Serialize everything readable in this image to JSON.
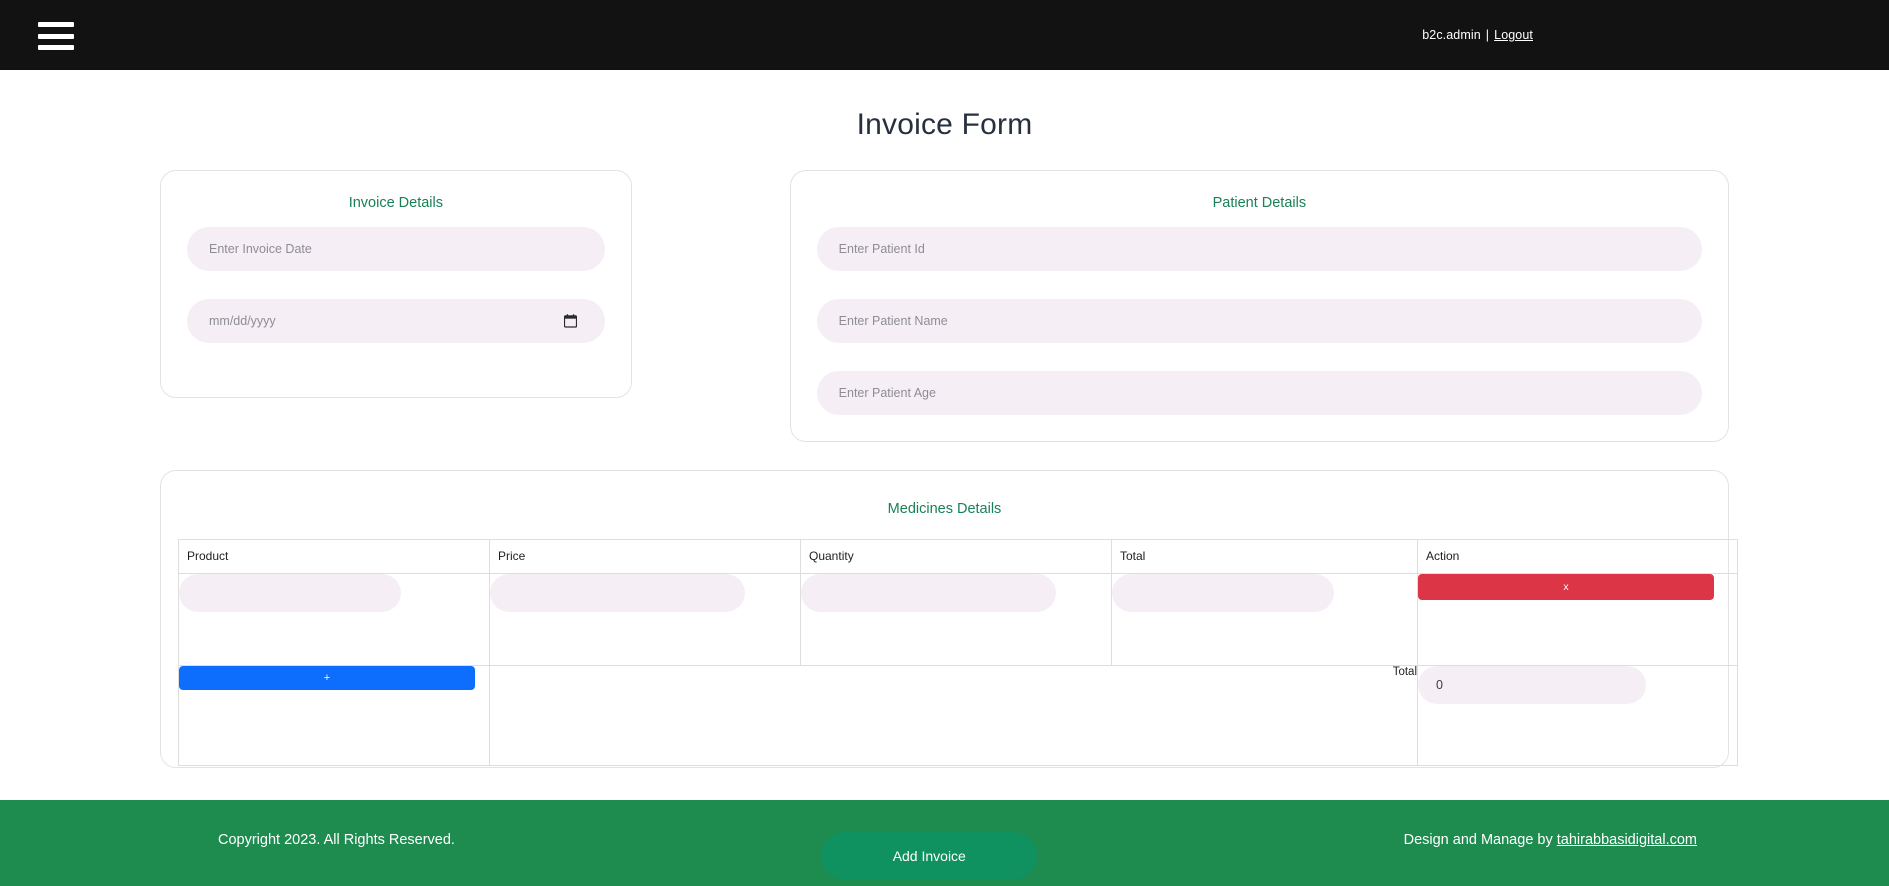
{
  "navbar": {
    "menu_icon": "hamburger-menu-icon",
    "user": "b2c.admin",
    "separator": "|",
    "logout": "Logout"
  },
  "page": {
    "title": "Invoice Form"
  },
  "invoice_details": {
    "title": "Invoice Details",
    "fields": [
      {
        "name": "invoice-date-text",
        "placeholder": "Enter Invoice Date",
        "value": ""
      },
      {
        "name": "invoice-date-picker",
        "placeholder": "mm/dd/yyyy",
        "value": ""
      }
    ]
  },
  "patient_details": {
    "title": "Patient Details",
    "fields": [
      {
        "name": "patient-id",
        "placeholder": "Enter Patient Id",
        "value": ""
      },
      {
        "name": "patient-name",
        "placeholder": "Enter Patient Name",
        "value": ""
      },
      {
        "name": "patient-age",
        "placeholder": "Enter Patient Age",
        "value": ""
      }
    ]
  },
  "medicines_details": {
    "title": "Medicines Details",
    "columns": [
      "Product",
      "Price",
      "Quantity",
      "Total",
      "Action"
    ],
    "rows": [
      {
        "product": "",
        "price": "",
        "quantity": "",
        "total": "",
        "action_label": "x"
      }
    ],
    "add_row_label": "+",
    "grand_total_label": "Total",
    "grand_total_value": "0"
  },
  "footer": {
    "copyright": "Copyright 2023. All Rights Reserved.",
    "add_invoice_label": "Add Invoice",
    "credit_prefix": "Design and Manage by ",
    "credit_link": "tahirabbasidigital.com"
  },
  "colors": {
    "navbar_bg": "#121212",
    "heading_green": "#198057",
    "footer_green": "#1e8b4f",
    "button_green": "#109160",
    "danger_red": "#dc3545",
    "primary_blue": "#0d6efd",
    "field_bg": "#f6eef5",
    "title_navy": "#26303f"
  }
}
